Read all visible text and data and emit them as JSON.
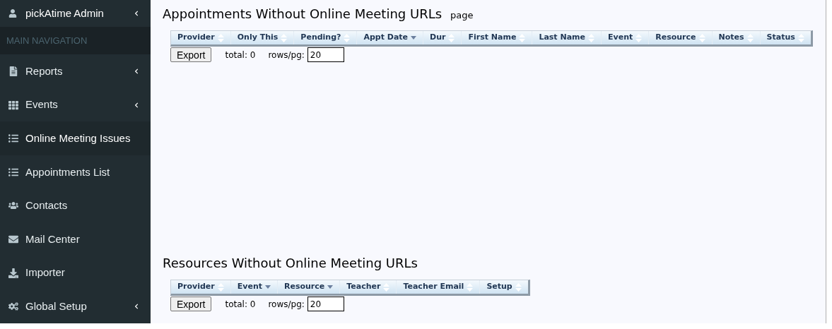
{
  "sidebar": {
    "user": {
      "name": "pickAtime Admin",
      "expanded": false
    },
    "section_label": "MAIN NAVIGATION",
    "items": [
      {
        "label": "Reports",
        "selected": false,
        "has_submenu": true
      },
      {
        "label": "Events",
        "selected": false,
        "has_submenu": true
      },
      {
        "label": "Online Meeting Issues",
        "selected": true,
        "has_submenu": false
      },
      {
        "label": "Appointments List",
        "selected": false,
        "has_submenu": false
      },
      {
        "label": "Contacts",
        "selected": false,
        "has_submenu": false
      },
      {
        "label": "Mail Center",
        "selected": false,
        "has_submenu": false
      },
      {
        "label": "Importer",
        "selected": false,
        "has_submenu": false
      },
      {
        "label": "Global Setup",
        "selected": false,
        "has_submenu": true
      }
    ]
  },
  "sections": [
    {
      "title": "Appointments Without Online Meeting URLs",
      "subtitle": "page",
      "columns": [
        {
          "label": "Provider",
          "sorted_desc": false
        },
        {
          "label": "Only This",
          "sorted_desc": false
        },
        {
          "label": "Pending?",
          "sorted_desc": false
        },
        {
          "label": "Appt Date",
          "sorted_desc": true
        },
        {
          "label": "Dur",
          "sorted_desc": false
        },
        {
          "label": "First Name",
          "sorted_desc": false
        },
        {
          "label": "Last Name",
          "sorted_desc": false
        },
        {
          "label": "Event",
          "sorted_desc": false
        },
        {
          "label": "Resource",
          "sorted_desc": false
        },
        {
          "label": "Notes",
          "sorted_desc": false
        },
        {
          "label": "Status",
          "sorted_desc": false
        }
      ],
      "export_button": "Export",
      "total": "total: 0",
      "rows_label": "rows/pg:",
      "rows_value": "20"
    },
    {
      "title": "Resources Without Online Meeting URLs",
      "columns": [
        {
          "label": "Provider",
          "sorted_desc": false
        },
        {
          "label": "Event",
          "sorted_desc": true
        },
        {
          "label": "Resource",
          "sorted_desc": true
        },
        {
          "label": "Teacher",
          "sorted_desc": false
        },
        {
          "label": "Teacher Email",
          "sorted_desc": false
        },
        {
          "label": "Setup",
          "sorted_desc": false
        }
      ],
      "export_button": "Export",
      "total": "total: 0",
      "rows_label": "rows/pg:",
      "rows_value": "20"
    }
  ]
}
